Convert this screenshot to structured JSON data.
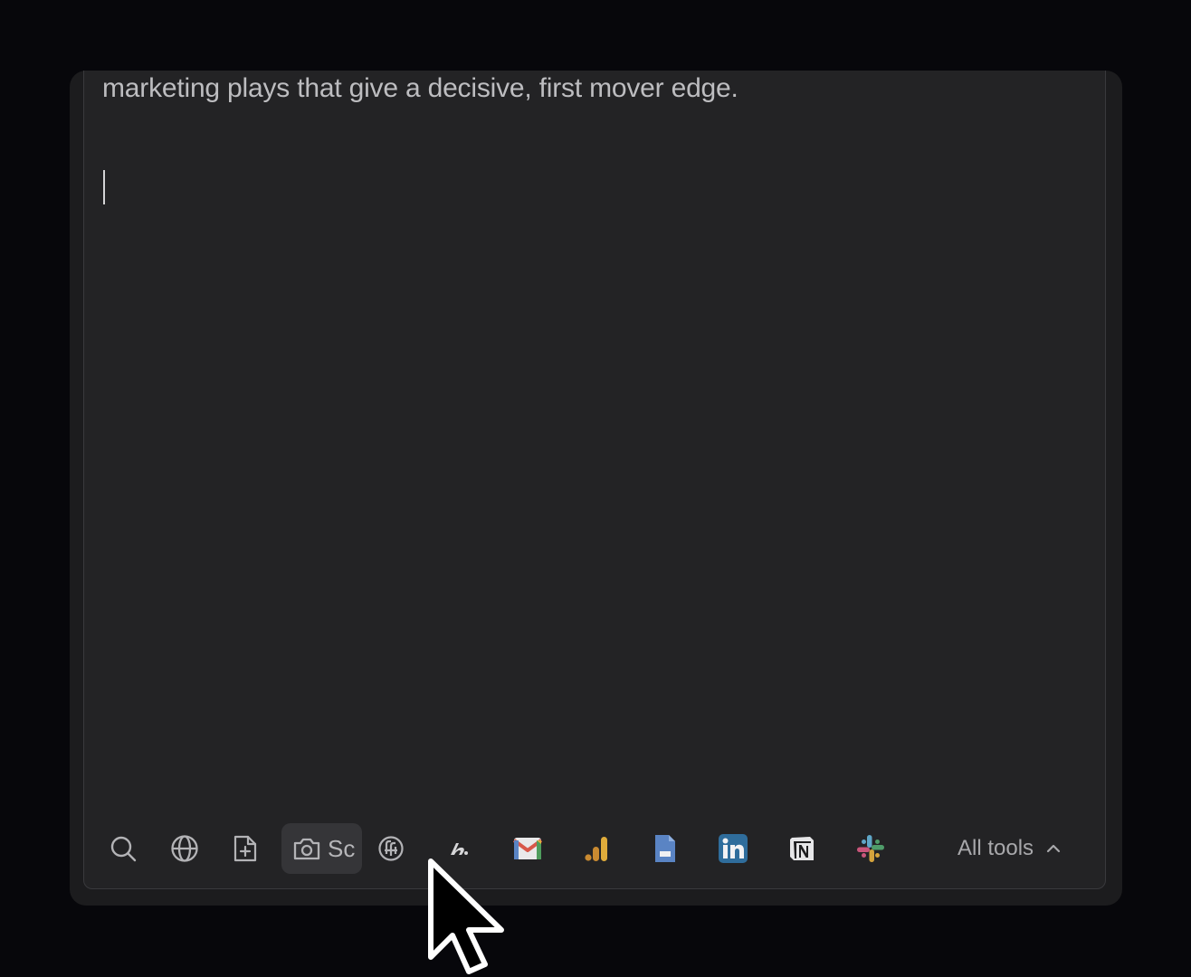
{
  "editor": {
    "text": "marketing plays that give a decisive, first mover edge."
  },
  "toolbar": {
    "tools": [
      {
        "icon": "search-icon"
      },
      {
        "icon": "globe-icon"
      },
      {
        "icon": "file-add-icon"
      },
      {
        "icon": "camera-icon",
        "label": "Sc"
      },
      {
        "icon": "openai-icon"
      },
      {
        "icon": "ahrefs-icon"
      },
      {
        "icon": "gmail-icon"
      },
      {
        "icon": "google-analytics-icon"
      },
      {
        "icon": "google-docs-icon"
      },
      {
        "icon": "linkedin-icon"
      },
      {
        "icon": "notion-icon"
      },
      {
        "icon": "slack-icon"
      }
    ],
    "all_tools_label": "All tools"
  },
  "colors": {
    "background": "#07070b",
    "card": "#1c1c1e",
    "editor": "#232325",
    "text": "#bdbdc0",
    "icon": "#b3b3b6",
    "gmail_red": "#d8584a",
    "analytics_orange": "#d9a237",
    "docs_blue": "#5a84c4",
    "linkedin_blue": "#2f6d9c"
  }
}
